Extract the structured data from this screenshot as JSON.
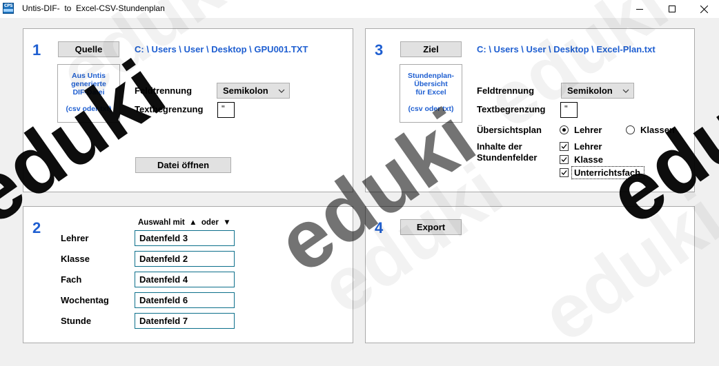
{
  "window": {
    "title": "Untis-DIF-  to  Excel-CSV-Stundenplan",
    "icon_text": "CPS"
  },
  "panel1": {
    "number": "1",
    "source_button": "Quelle",
    "source_path": "C: \\ Users \\ User \\ Desktop \\ GPU001.TXT",
    "info_line1": "Aus Untis",
    "info_line2": "generierte",
    "info_line3": "DIF-Datei",
    "info_line4": "(csv oder txt)",
    "separator_label": "Feldtrennung",
    "separator_value": "Semikolon",
    "text_delim_label": "Textbegrenzung",
    "text_delim_value": "\"",
    "open_button": "Datei öffnen"
  },
  "panel2": {
    "number": "2",
    "hint": "Auswahl mit  ▲  oder  ▼",
    "rows": [
      {
        "label": "Lehrer",
        "value": "Datenfeld 3"
      },
      {
        "label": "Klasse",
        "value": "Datenfeld 2"
      },
      {
        "label": "Fach",
        "value": "Datenfeld 4"
      },
      {
        "label": "Wochentag",
        "value": "Datenfeld 6"
      },
      {
        "label": "Stunde",
        "value": "Datenfeld 7"
      }
    ]
  },
  "panel3": {
    "number": "3",
    "target_button": "Ziel",
    "target_path": "C: \\ Users \\ User \\ Desktop \\ Excel-Plan.txt",
    "info_line1": "Stundenplan-",
    "info_line2": "Übersicht",
    "info_line3": "für Excel",
    "info_line4": "(csv oder txt)",
    "separator_label": "Feldtrennung",
    "separator_value": "Semikolon",
    "text_delim_label": "Textbegrenzung",
    "text_delim_value": "\"",
    "overview_label": "Übersichtsplan",
    "radio_teacher": "Lehrer",
    "radio_class": "Klassen",
    "contents_label_line1": "Inhalte der",
    "contents_label_line2": "Stundenfelder",
    "cb_teacher": "Lehrer",
    "cb_class": "Klasse",
    "cb_subject": "Unterrichtsfach",
    "radio_selected": "Lehrer",
    "checked": [
      "Lehrer",
      "Klasse",
      "Unterrichtsfach"
    ]
  },
  "panel4": {
    "number": "4",
    "export_button": "Export"
  },
  "watermark": {
    "text": "eduki"
  },
  "colors": {
    "accent_blue": "#1f5fd1",
    "field_border": "#0b6e8a",
    "panel_bg": "#ffffff",
    "window_bg": "#f0f0f0"
  },
  "icons": [
    "app-icon",
    "minimize-icon",
    "maximize-icon",
    "close-icon",
    "chevron-down-icon",
    "checkmark-icon"
  ]
}
